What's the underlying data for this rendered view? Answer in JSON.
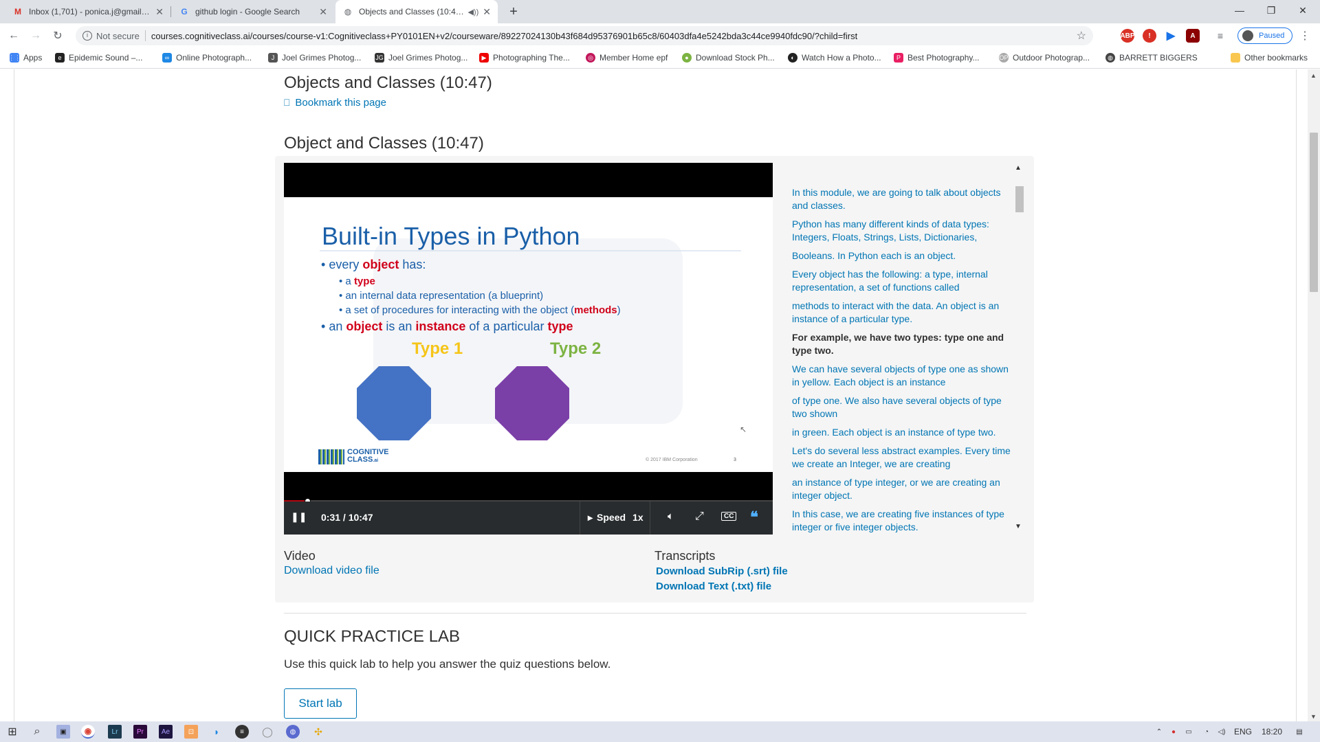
{
  "tabs": [
    {
      "title": "Inbox (1,701) - ponica.j@gmail.co",
      "icon": "gmail-icon",
      "active": false
    },
    {
      "title": "github login - Google Search",
      "icon": "google-icon",
      "active": false
    },
    {
      "title": "Objects and Classes (10:47) |",
      "icon": "globe-icon",
      "active": true
    }
  ],
  "address_bar": {
    "security": "Not secure",
    "url": "courses.cognitiveclass.ai/courses/course-v1:Cognitiveclass+PY0101EN+v2/courseware/89227024130b43f684d95376901b65c8/60403dfa4e5242bda3c44ce9940fdc90/?child=first"
  },
  "profile": {
    "status": "Paused"
  },
  "bookmarks": [
    "Apps",
    "Epidemic Sound –...",
    "Online Photograph...",
    "Joel Grimes Photog...",
    "Joel Grimes Photog...",
    "Photographing The...",
    "Member Home epf",
    "Download Stock Ph...",
    "Watch How a Photo...",
    "Best Photography...",
    "Outdoor Photograp...",
    "BARRETT BIGGERS"
  ],
  "other_bookmarks": "Other bookmarks",
  "page": {
    "unit_title": "Objects and Classes (10:47)",
    "bookmark_link": "Bookmark this page",
    "video_title": "Object and Classes (10:47)"
  },
  "slide": {
    "title": "Built-in Types in Python",
    "bullet1_pre": "every ",
    "bullet1_em": "object",
    "bullet1_post": " has:",
    "sub1_pre": "a ",
    "sub1_em": "type",
    "sub2": "an internal data representation (a blueprint)",
    "sub3_pre": "a set of procedures for interacting with the object (",
    "sub3_em": "methods",
    "sub3_post": ")",
    "bullet2_pre": "an ",
    "bullet2_em1": "object",
    "bullet2_mid": " is an ",
    "bullet2_em2": "instance",
    "bullet2_mid2": " of a particular ",
    "bullet2_em3": "type",
    "type1_label": "Type 1",
    "type2_label": "Type 2",
    "logo_line1": "COGNITIVE",
    "logo_line2": "CLASS",
    "logo_suffix": ".ai",
    "copyright": "© 2017 IBM Corporation",
    "page_number": "3",
    "colors": {
      "title": "#1a5fa8",
      "accent": "#d0021b",
      "type1": "#f5c518",
      "type2": "#7cb342",
      "octagon1": "#4472c4",
      "octagon2": "#7b3fa8"
    }
  },
  "player": {
    "time": "0:31 / 10:47",
    "progress": 0.048,
    "speed_label": "Speed",
    "speed_value": "1x"
  },
  "transcript": [
    {
      "text": "In this module, we are going to talk about objects and classes.",
      "current": false
    },
    {
      "text": "Python has many different kinds of data types: Integers, Floats, Strings, Lists, Dictionaries,",
      "current": false
    },
    {
      "text": "Booleans. In Python each is an object.",
      "current": false
    },
    {
      "text": "Every object has the following: a type, internal representation, a set of functions called",
      "current": false
    },
    {
      "text": "methods to interact with the data. An object is an instance of a particular type.",
      "current": false
    },
    {
      "text": "For example, we have two types: type one and type two.",
      "current": true
    },
    {
      "text": "We can have several objects of type one as shown in yellow. Each object is an instance",
      "current": false
    },
    {
      "text": "of type one. We also have several objects of type two shown",
      "current": false
    },
    {
      "text": "in green. Each object is an instance of type two.",
      "current": false
    },
    {
      "text": "Let's do several less abstract examples. Every time we create an Integer, we are creating",
      "current": false
    },
    {
      "text": "an instance of type integer, or we are creating an integer object.",
      "current": false
    },
    {
      "text": "In this case, we are creating five instances of type integer or five integer objects.",
      "current": false
    }
  ],
  "downloads": {
    "video_heading": "Video",
    "video_link": "Download video file",
    "transcripts_heading": "Transcripts",
    "srt_link": "Download SubRip (.srt) file",
    "txt_link": "Download Text (.txt) file"
  },
  "lab": {
    "heading": "QUICK PRACTICE LAB",
    "description": "Use this quick lab to help you answer the quiz questions below.",
    "button": "Start lab"
  },
  "taskbar": {
    "language": "ENG",
    "time": "18:20"
  }
}
